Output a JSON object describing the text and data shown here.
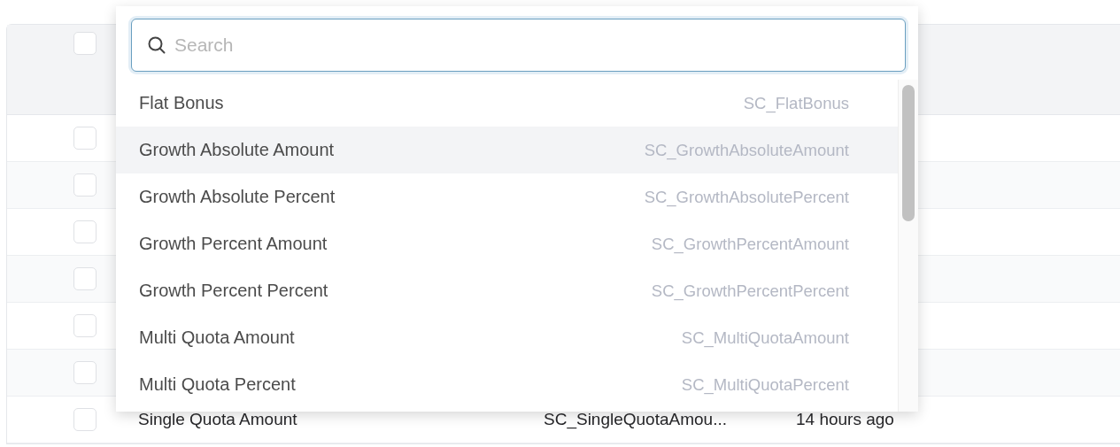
{
  "table": {
    "header_checked": false,
    "rows": [
      {
        "checked": false
      },
      {
        "checked": false
      },
      {
        "checked": false
      },
      {
        "checked": false
      },
      {
        "checked": false
      },
      {
        "checked": false
      },
      {
        "checked": false,
        "name": "Single Quota Amount",
        "code": "SC_SingleQuotaAmou...",
        "updated": "14 hours ago"
      }
    ]
  },
  "dropdown": {
    "search": {
      "placeholder": "Search"
    },
    "items": [
      {
        "label": "Flat Bonus",
        "code": "SC_FlatBonus",
        "selected": false
      },
      {
        "label": "Growth Absolute Amount",
        "code": "SC_GrowthAbsoluteAmount",
        "selected": true
      },
      {
        "label": "Growth Absolute Percent",
        "code": "SC_GrowthAbsolutePercent",
        "selected": false
      },
      {
        "label": "Growth Percent Amount",
        "code": "SC_GrowthPercentAmount",
        "selected": false
      },
      {
        "label": "Growth Percent Percent",
        "code": "SC_GrowthPercentPercent",
        "selected": false
      },
      {
        "label": "Multi Quota Amount",
        "code": "SC_MultiQuotaAmount",
        "selected": false
      },
      {
        "label": "Multi Quota Percent",
        "code": "SC_MultiQuotaPercent",
        "selected": false
      }
    ]
  }
}
